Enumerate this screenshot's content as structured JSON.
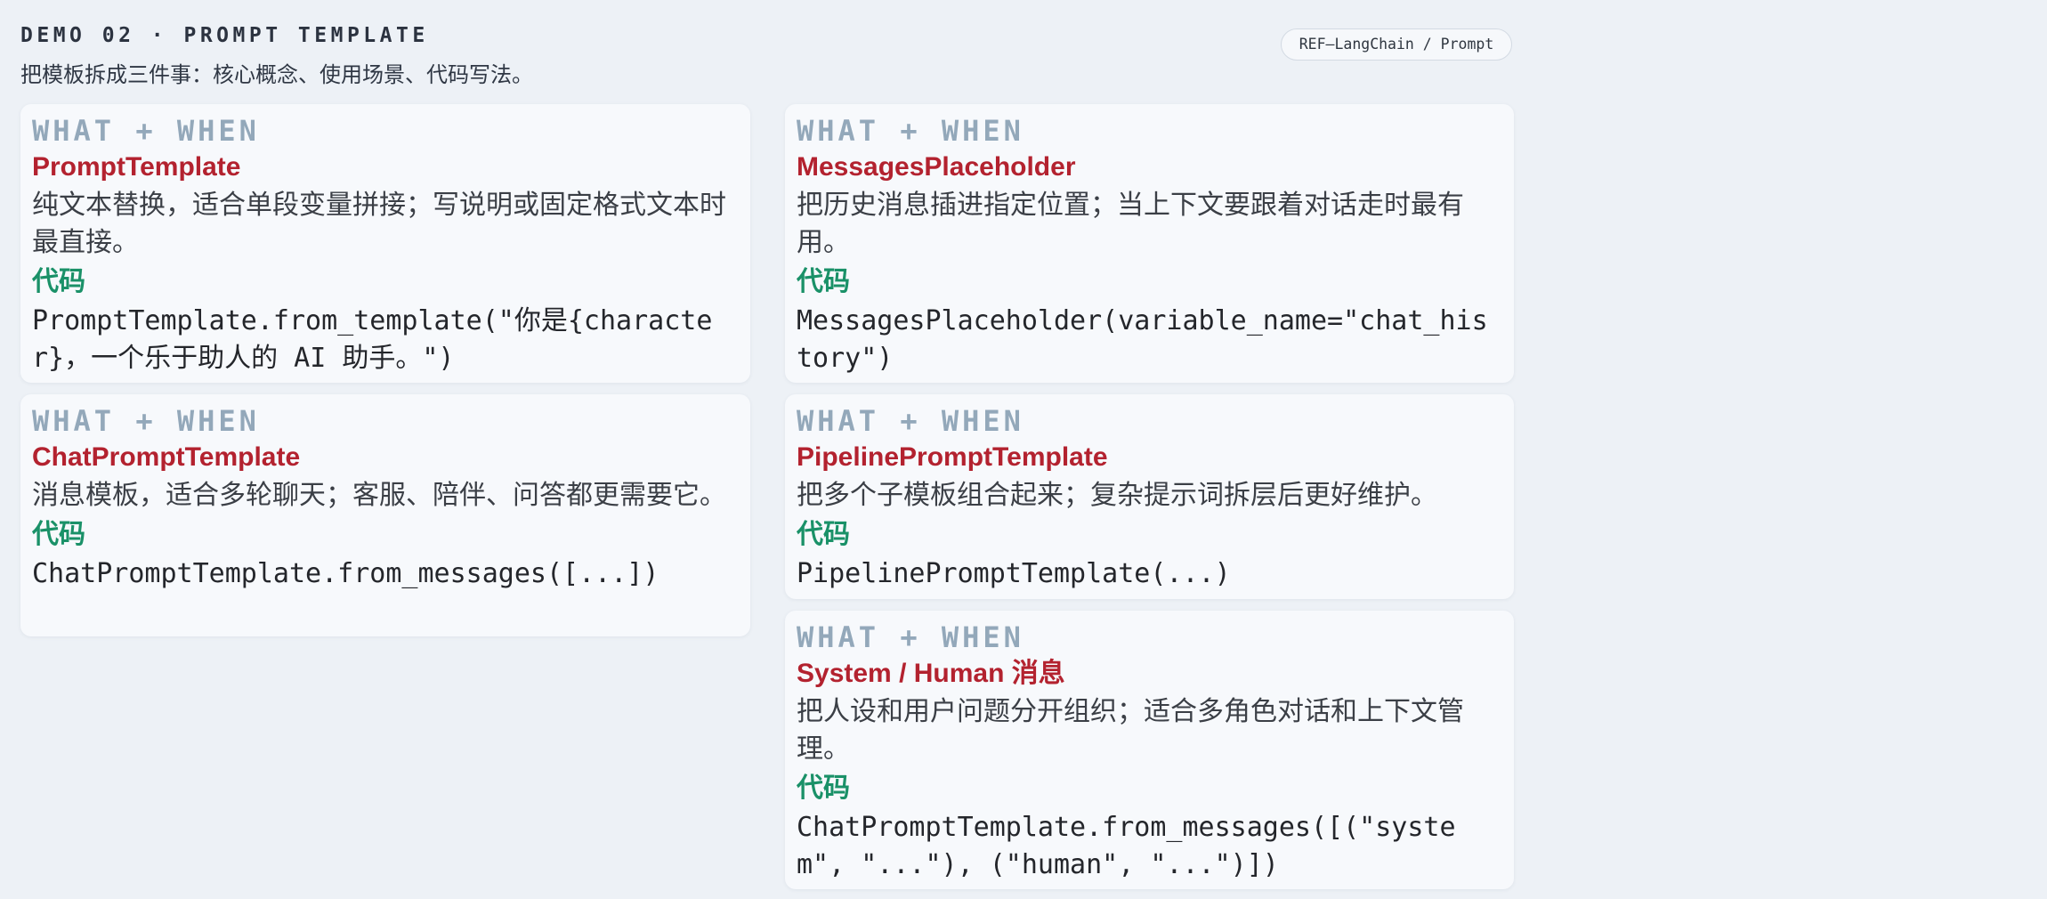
{
  "header": {
    "kicker": "DEMO 02 · PROMPT TEMPLATE",
    "subtitle": "把模板拆成三件事：核心概念、使用场景、代码写法。",
    "ref_label": "REF—LangChain / Prompt"
  },
  "cards": [
    {
      "label": "WHAT + WHEN",
      "title": "PromptTemplate",
      "description": "纯文本替换，适合单段变量拼接；写说明或固定格式文本时最直接。",
      "code_label": "代码",
      "code": "PromptTemplate.from_template(\"你是{character}，一个乐于助人的 AI 助手。\")"
    },
    {
      "label": "WHAT + WHEN",
      "title": "MessagesPlaceholder",
      "description": "把历史消息插进指定位置；当上下文要跟着对话走时最有用。",
      "code_label": "代码",
      "code": "MessagesPlaceholder(variable_name=\"chat_history\")"
    },
    {
      "label": "WHAT + WHEN",
      "title": "ChatPromptTemplate",
      "description": "消息模板，适合多轮聊天；客服、陪伴、问答都更需要它。",
      "code_label": "代码",
      "code": "ChatPromptTemplate.from_messages([...])"
    },
    {
      "label": "WHAT + WHEN",
      "title": "PipelinePromptTemplate",
      "description": "把多个子模板组合起来；复杂提示词拆层后更好维护。",
      "code_label": "代码",
      "code": "PipelinePromptTemplate(...)"
    },
    {
      "label": "WHAT + WHEN",
      "title": "System / Human 消息",
      "description": "把人设和用户问题分开组织；适合多角色对话和上下文管理。",
      "code_label": "代码",
      "code": "ChatPromptTemplate.from_messages([(\"system\", \"...\"), (\"human\", \"...\")])"
    }
  ]
}
